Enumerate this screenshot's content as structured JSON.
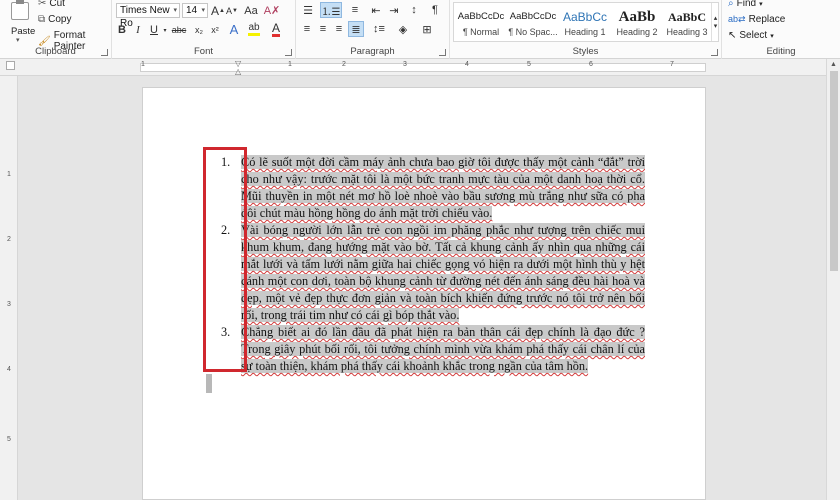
{
  "clipboard": {
    "paste": "Paste",
    "cut": "Cut",
    "copy": "Copy",
    "format_painter": "Format Painter",
    "label": "Clipboard"
  },
  "font": {
    "name": "Times New Ro",
    "size": "14",
    "label": "Font",
    "grow": "A",
    "shrink": "A",
    "case": "Aa",
    "bold": "B",
    "italic": "I",
    "underline": "U",
    "strike": "abc",
    "sub": "x₂",
    "sup": "x²",
    "font_color": "A",
    "highlight": "ab"
  },
  "paragraph": {
    "label": "Paragraph",
    "pilcrow": "¶"
  },
  "styles": {
    "label": "Styles",
    "items": [
      {
        "preview": "AaBbCcDc",
        "name": "¶ Normal"
      },
      {
        "preview": "AaBbCcDc",
        "name": "¶ No Spac..."
      },
      {
        "preview": "AaBbCc",
        "name": "Heading 1"
      },
      {
        "preview": "AaBb",
        "name": "Heading 2"
      },
      {
        "preview": "AaBbC",
        "name": "Heading 3"
      }
    ]
  },
  "editing": {
    "label": "Editing",
    "find": "Find",
    "replace": "Replace",
    "select": "Select"
  },
  "ruler": {
    "numbers": [
      "1",
      "1",
      "2",
      "3",
      "4",
      "5",
      "6",
      "7"
    ],
    "vnumbers": [
      "1",
      "2",
      "3",
      "4",
      "5"
    ]
  },
  "document": {
    "items": [
      {
        "num": "1.",
        "text": "Có lẽ suốt một đời cầm máy ảnh chưa bao giờ tôi được thấy một cảnh “đắt” trời cho như vậy: trước mặt tôi là một bức tranh mực tàu của một danh hoạ thời cổ. Mũi thuyền in một nét mơ hồ loè nhoè vào bầu sương mù trắng như sữa có pha đôi chút màu hồng hồng do ánh mặt trời chiếu vào."
      },
      {
        "num": "2.",
        "text": "Vài bóng người lớn lẫn trẻ con ngồi im phăng phắc như tượng trên chiếc mui khum khum, đang hướng mặt vào bờ. Tất cả khung cảnh ấy nhìn qua những cái mắt lưới và tấm lưới nằm giữa hai chiếc gọng vó hiện ra dưới một hình thù y hệt cánh một con dơi, toàn bộ khung cảnh từ đường nét đến ánh sáng đều hài hoà và đẹp, một vẻ đẹp thực đơn giản và toàn bích khiến đứng trước nó tôi trở nên bối rối, trong trái tim như có cái gì bóp thắt vào."
      },
      {
        "num": "3.",
        "text": "Chẳng biết ai đó lần đầu đã phát hiện ra bản thân cái đẹp chính là đạo đức ? Trong giây phút bối rối, tôi tưởng chính mình vừa khám phá thấy cái chân lí của sự toàn thiện, khám phá thấy cái khoảnh khắc trong ngần của tâm hồn."
      }
    ]
  },
  "colors": {
    "selection": "#c9c9c9",
    "annotation": "#d0282e",
    "font_color_bar": "#e03030",
    "highlight_bar": "#f5f200"
  }
}
